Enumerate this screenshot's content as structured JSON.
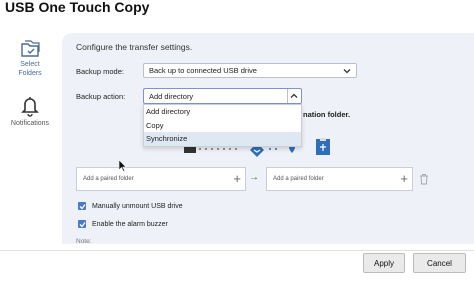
{
  "window": {
    "title": "USB One Touch Copy"
  },
  "sidebar": {
    "items": [
      {
        "label_line1": "Select",
        "label_line2": "Folders",
        "icon": "folder-select-icon",
        "active": true
      },
      {
        "label_line1": "Notifications",
        "label_line2": "",
        "icon": "bell-icon",
        "active": false
      }
    ]
  },
  "settings": {
    "heading": "Configure the transfer settings.",
    "backup_mode": {
      "label": "Backup mode:",
      "value": "Back up to connected USB drive"
    },
    "backup_action": {
      "label": "Backup action:",
      "value": "Add directory",
      "options": [
        "Add directory",
        "Copy",
        "Synchronize"
      ],
      "hovered_option": "Synchronize"
    },
    "destination_text": "nation folder."
  },
  "pairing": {
    "source_placeholder": "Add a paired folder",
    "target_placeholder": "Add a paired folder",
    "arrow": "→"
  },
  "options": {
    "unmount": {
      "label": "Manually unmount USB drive",
      "checked": true
    },
    "buzzer": {
      "label": "Enable the alarm buzzer",
      "checked": true
    }
  },
  "note_label": "Note:",
  "buttons": {
    "apply": "Apply",
    "cancel": "Cancel"
  },
  "colors": {
    "accent": "#4d7ac8",
    "panel": "#eef1f7",
    "usb_blue": "#2f6fb8"
  }
}
